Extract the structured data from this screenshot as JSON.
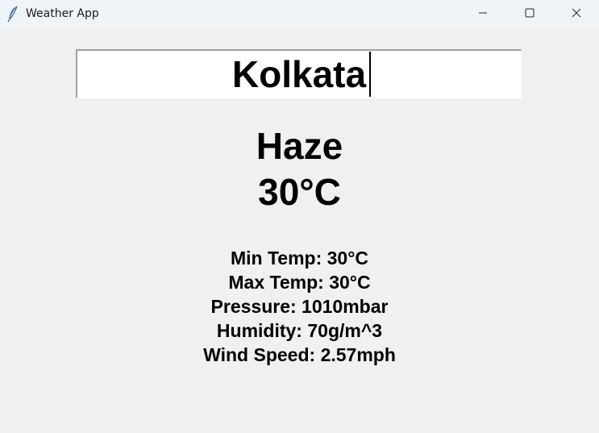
{
  "window": {
    "title": "Weather App",
    "app_icon": "feather-icon",
    "controls": {
      "minimize_icon": "minimize-icon",
      "maximize_icon": "maximize-icon",
      "close_icon": "close-icon"
    }
  },
  "search": {
    "value": "Kolkata"
  },
  "weather": {
    "condition": "Haze",
    "temperature": "30°C"
  },
  "details": {
    "min_temp": "Min Temp: 30°C",
    "max_temp": "Max Temp: 30°C",
    "pressure": "Pressure: 1010mbar",
    "humidity": "Humidity: 70g/m^3",
    "wind_speed": "Wind Speed: 2.57mph"
  }
}
